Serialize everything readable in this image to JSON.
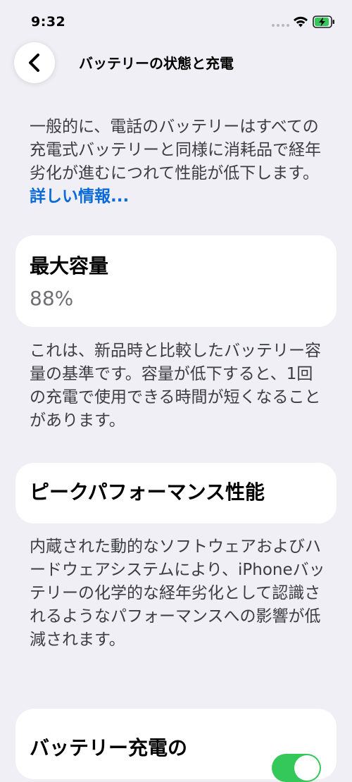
{
  "status_bar": {
    "time": "9:32",
    "icons": [
      "cellular-icon",
      "wifi-icon",
      "battery-charging-icon"
    ],
    "battery_color": "#34c759"
  },
  "nav": {
    "back_icon": "chevron-left-icon",
    "title": "バッテリーの状態と充電"
  },
  "intro": {
    "text": "一般的に、電話のバッテリーはすべての充電式バッテリーと同様に消耗品で経年劣化が進むにつれて性能が低下します。",
    "link": "詳しい情報..."
  },
  "capacity": {
    "title": "最大容量",
    "value": "88%",
    "description": "これは、新品時と比較したバッテリー容量の基準です。容量が低下すると、1回の充電で使用できる時間が短くなることがあります。"
  },
  "peak": {
    "title": "ピークパフォーマンス性能",
    "description": "内蔵された動的なソフトウェアおよびハードウェアシステムにより、iPhoneバッテリーの化学的な経年劣化として認識されるようなパフォーマンスへの影響が低減されます。"
  },
  "charging": {
    "title": "バッテリー充電の",
    "toggle_on": true
  },
  "colors": {
    "background": "#f0eff5",
    "link": "#0a6ad8",
    "toggle_on": "#34c759"
  }
}
